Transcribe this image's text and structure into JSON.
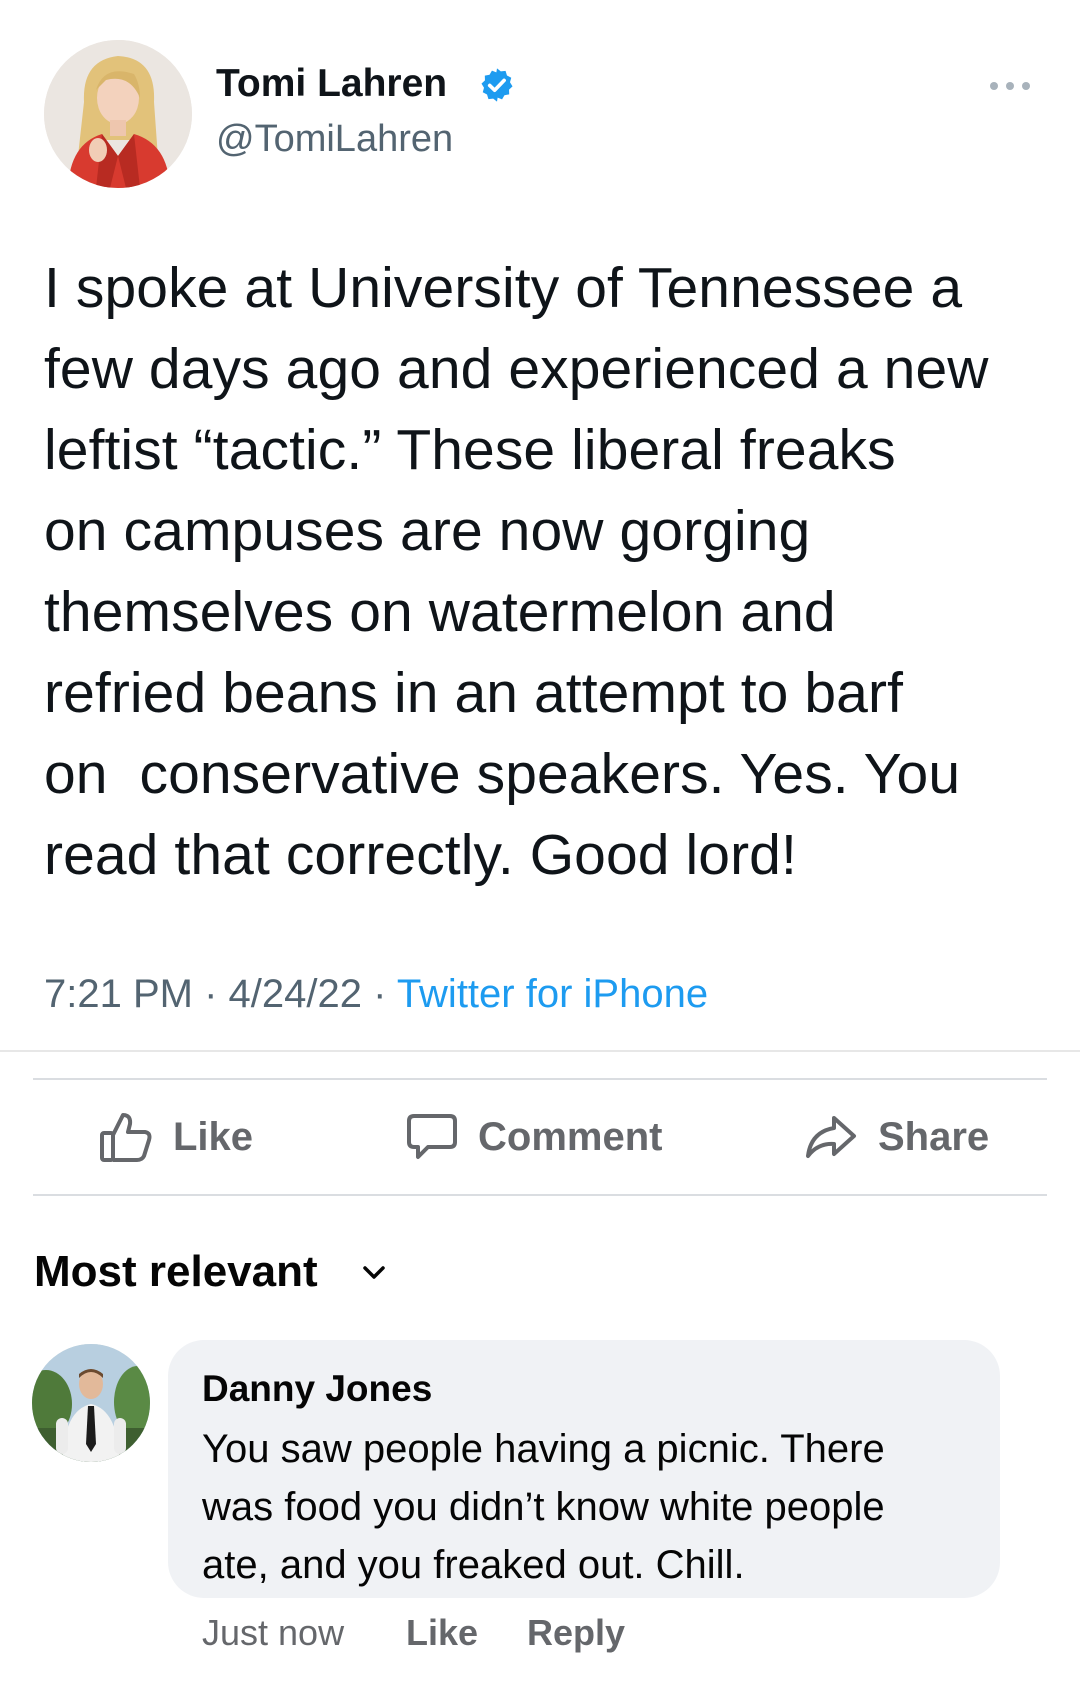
{
  "tweet": {
    "author_name": "Tomi Lahren",
    "author_handle": "@TomiLahren",
    "verified_icon": "verified-badge-icon",
    "more_icon": "more-options-icon",
    "text_lines": [
      "I spoke at University of Tennessee a",
      "few days ago and experienced a new",
      "leftist “tactic.” These liberal freaks",
      "on campuses are now gorging",
      "themselves on watermelon and",
      "refried beans in an attempt to barf",
      "on  conservative speakers. Yes. You",
      "read that correctly. Good lord!"
    ],
    "time": "7:21 PM",
    "separator": " · ",
    "date": "4/24/22",
    "source": "Twitter for iPhone"
  },
  "actions": {
    "like_label": "Like",
    "comment_label": "Comment",
    "share_label": "Share"
  },
  "comments": {
    "sort_label": "Most relevant",
    "items": [
      {
        "author": "Danny Jones",
        "text_lines": [
          "You saw people having a picnic. There",
          "was food you didn’t know white people",
          "ate, and you freaked out. Chill."
        ],
        "time": "Just now",
        "like_label": "Like",
        "reply_label": "Reply"
      }
    ]
  },
  "colors": {
    "twitter_blue": "#1d9bf0",
    "secondary_text": "#536471",
    "fb_secondary": "#65676b",
    "bubble_bg": "#f0f2f5"
  }
}
